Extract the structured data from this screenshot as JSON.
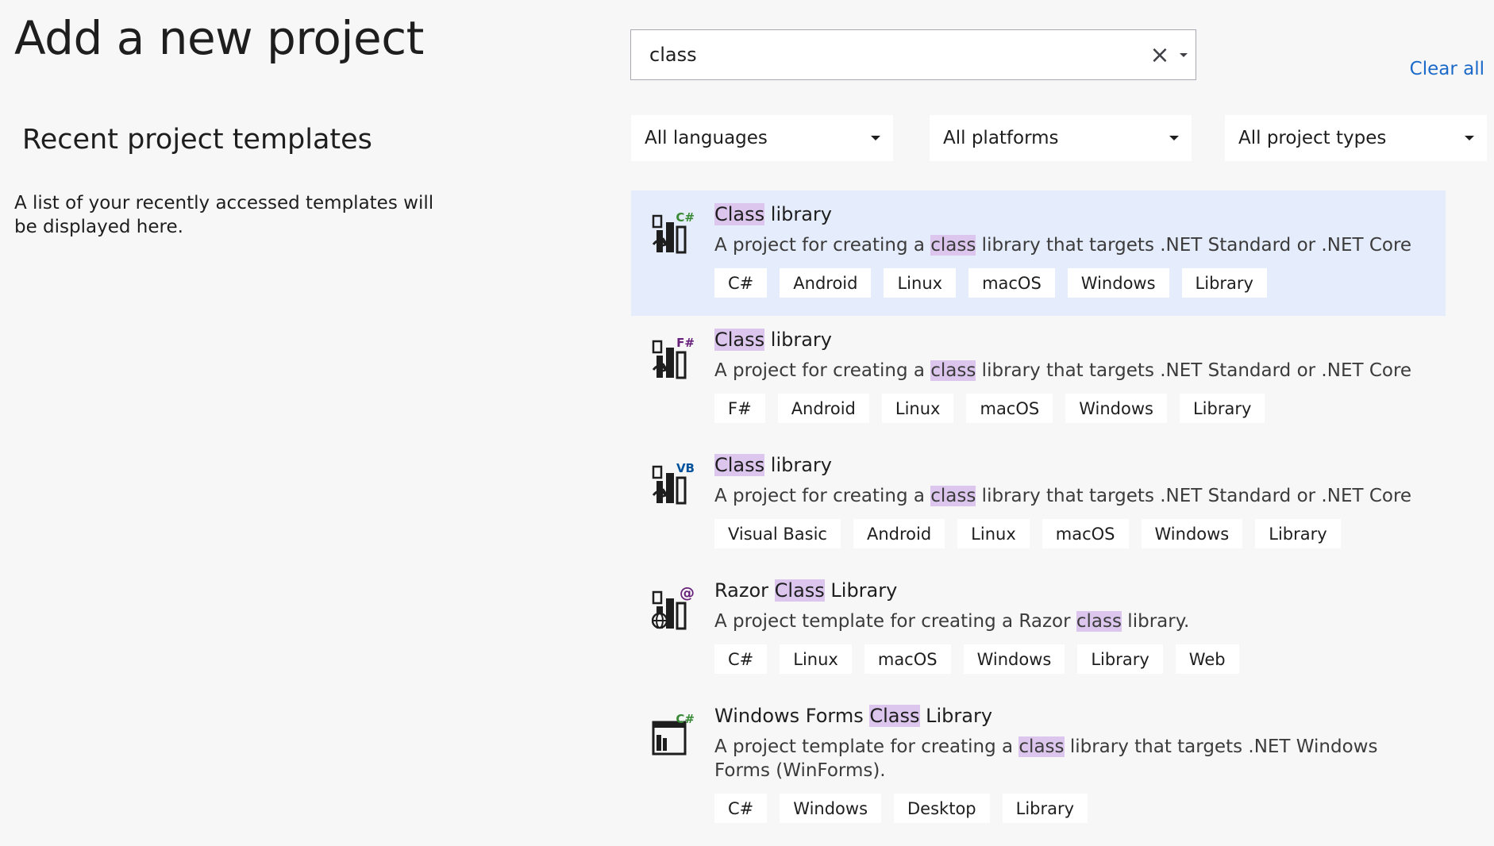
{
  "page_title": "Add a new project",
  "recent": {
    "heading": "Recent project templates",
    "description": "A list of your recently accessed templates will be displayed here."
  },
  "search": {
    "value": "class",
    "clear_icon": "×"
  },
  "clear_all": "Clear all",
  "filters": {
    "language": "All languages",
    "platform": "All platforms",
    "project_type": "All project types"
  },
  "colors": {
    "accent_link": "#1b6ac9",
    "selected_row": "#e5ecfb",
    "highlight": "#dcc6ee",
    "csharp_badge": "#388a34",
    "fsharp_badge": "#68217a",
    "vb_badge": "#00539c"
  },
  "templates": [
    {
      "title": {
        "before": "",
        "match": "Class",
        "after": " library"
      },
      "desc": {
        "before": "A project for creating a ",
        "match": "class",
        "after": " library that targets .NET Standard or .NET Core"
      },
      "badge": "C#",
      "icon": "csharp-class-library-icon",
      "tags": [
        "C#",
        "Android",
        "Linux",
        "macOS",
        "Windows",
        "Library"
      ]
    },
    {
      "title": {
        "before": "",
        "match": "Class",
        "after": " library"
      },
      "desc": {
        "before": "A project for creating a ",
        "match": "class",
        "after": " library that targets .NET Standard or .NET Core"
      },
      "badge": "F#",
      "icon": "fsharp-class-library-icon",
      "tags": [
        "F#",
        "Android",
        "Linux",
        "macOS",
        "Windows",
        "Library"
      ]
    },
    {
      "title": {
        "before": "",
        "match": "Class",
        "after": " library"
      },
      "desc": {
        "before": "A project for creating a ",
        "match": "class",
        "after": " library that targets .NET Standard or .NET Core"
      },
      "badge": "VB",
      "icon": "vb-class-library-icon",
      "tags": [
        "Visual Basic",
        "Android",
        "Linux",
        "macOS",
        "Windows",
        "Library"
      ]
    },
    {
      "title": {
        "before": "Razor ",
        "match": "Class",
        "after": " Library"
      },
      "desc": {
        "before": "A project template for creating a Razor ",
        "match": "class",
        "after": " library."
      },
      "badge": "@",
      "icon": "razor-class-library-icon",
      "tags": [
        "C#",
        "Linux",
        "macOS",
        "Windows",
        "Library",
        "Web"
      ]
    },
    {
      "title": {
        "before": "Windows Forms ",
        "match": "Class",
        "after": " Library"
      },
      "desc": {
        "before": "A project template for creating a ",
        "match": "class",
        "after": " library that targets .NET Windows Forms (WinForms)."
      },
      "badge": "C#",
      "icon": "winforms-class-library-icon",
      "tags": [
        "C#",
        "Windows",
        "Desktop",
        "Library"
      ]
    }
  ]
}
